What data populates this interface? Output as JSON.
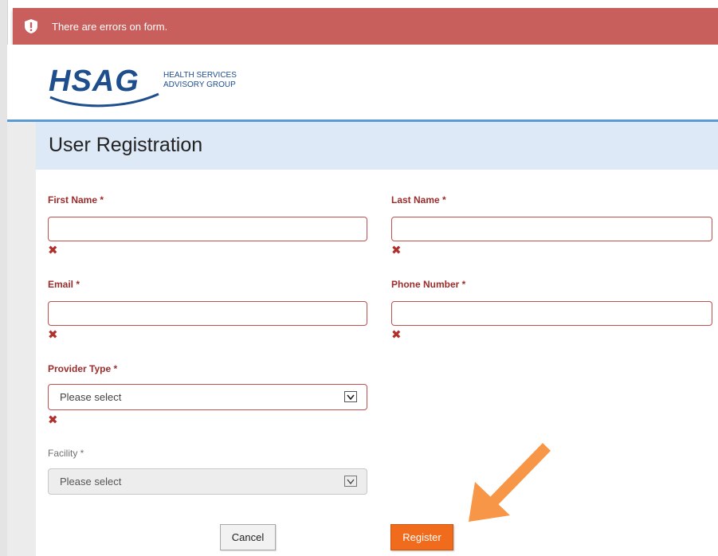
{
  "error_banner": {
    "message": "There are errors on form.",
    "icon": "shield-alert-icon",
    "color": "#c85f5c"
  },
  "logo": {
    "wordmark": "HSAG",
    "line1": "HEALTH SERVICES",
    "line2": "ADVISORY GROUP"
  },
  "page": {
    "title": "User Registration"
  },
  "form": {
    "first_name": {
      "label": "First Name *",
      "value": ""
    },
    "last_name": {
      "label": "Last Name *",
      "value": ""
    },
    "email": {
      "label": "Email *",
      "value": ""
    },
    "phone": {
      "label": "Phone Number *",
      "value": ""
    },
    "provider_type": {
      "label": "Provider Type *",
      "selected": "Please select"
    },
    "facility": {
      "label": "Facility *",
      "selected": "Please select"
    },
    "error_glyph": "✖"
  },
  "buttons": {
    "cancel": "Cancel",
    "register": "Register",
    "register_color": "#f06b1b"
  },
  "annotation": {
    "arrow_color": "#f79646"
  }
}
